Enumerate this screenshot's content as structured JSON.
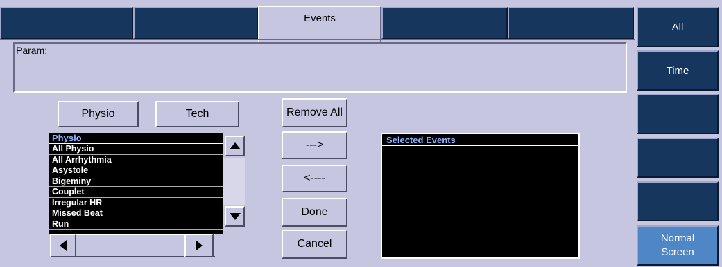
{
  "tabs": [
    {
      "label": ""
    },
    {
      "label": ""
    },
    {
      "label": "Events",
      "active": true
    },
    {
      "label": ""
    },
    {
      "label": ""
    }
  ],
  "param": {
    "label": "Param:"
  },
  "category_buttons": {
    "physio": "Physio",
    "tech": "Tech"
  },
  "event_list": {
    "header": "Physio",
    "items": [
      "All Physio",
      "All Arrhythmia",
      "Asystole",
      "Bigeminy",
      "Couplet",
      "Irregular HR",
      "Missed Beat",
      "Run"
    ]
  },
  "action_buttons": {
    "remove_all": "Remove All",
    "add": "--->",
    "remove": "<----",
    "done": "Done",
    "cancel": "Cancel"
  },
  "selected_events": {
    "header": "Selected Events",
    "items": []
  },
  "side_buttons": {
    "all": "All",
    "time": "Time",
    "blank1": "",
    "blank2": "",
    "blank3": "",
    "normal_screen_line1": "Normal",
    "normal_screen_line2": "Screen"
  },
  "colors": {
    "panel": "#c7c6e1",
    "navy": "#17365d",
    "accent_blue": "#4f87c6",
    "list_header": "#8fb3ff"
  }
}
